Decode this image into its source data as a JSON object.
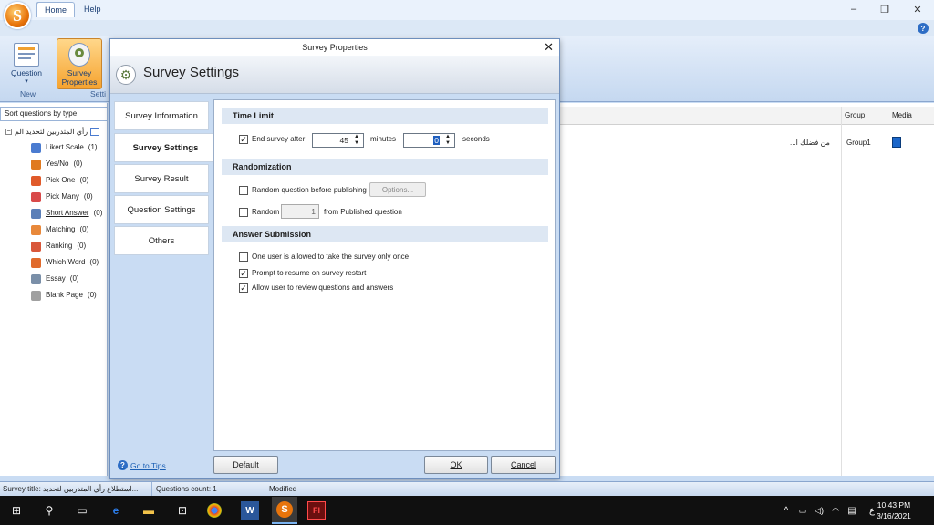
{
  "ribbon": {
    "tabs": [
      "Home",
      "Help"
    ],
    "question_label": "Question",
    "survey_props_label": "Survey Properties",
    "group_new": "New",
    "group_settings": "Setti"
  },
  "left": {
    "sort_label": "Sort questions by type",
    "root_label": "رأي المتدربين لتحديد الم",
    "items": [
      {
        "label": "Likert Scale",
        "count": "(1)",
        "color": "#4a7bd0"
      },
      {
        "label": "Yes/No",
        "count": "(0)",
        "color": "#e07a1f"
      },
      {
        "label": "Pick One",
        "count": "(0)",
        "color": "#e05a2a"
      },
      {
        "label": "Pick Many",
        "count": "(0)",
        "color": "#d94a4a"
      },
      {
        "label": "Short Answer",
        "count": "(0)",
        "color": "#5b7fb8"
      },
      {
        "label": "Matching",
        "count": "(0)",
        "color": "#e8883a"
      },
      {
        "label": "Ranking",
        "count": "(0)",
        "color": "#d9573a"
      },
      {
        "label": "Which Word",
        "count": "(0)",
        "color": "#e06a2c"
      },
      {
        "label": "Essay",
        "count": "(0)",
        "color": "#7a8fa8"
      },
      {
        "label": "Blank Page",
        "count": "(0)",
        "color": "#a0a0a0"
      }
    ]
  },
  "grid": {
    "col_group": "Group",
    "col_media": "Media",
    "row_question": "...من فضلك ا",
    "row_group": "Group1"
  },
  "dialog": {
    "title": "Survey Properties",
    "header": "Survey Settings",
    "nav": [
      "Survey Information",
      "Survey Settings",
      "Survey Result",
      "Question Settings",
      "Others"
    ],
    "time_limit": {
      "heading": "Time Limit",
      "end_after_label": "End survey after",
      "end_after_checked": true,
      "minutes_value": "45",
      "minutes_label": "minutes",
      "seconds_value": "0",
      "seconds_label": "seconds"
    },
    "randomization": {
      "heading": "Randomization",
      "random_before_label": "Random question before publishing",
      "options_label": "Options...",
      "random_label": "Random",
      "random_value": "1",
      "from_published_label": "from Published question"
    },
    "answer_submission": {
      "heading": "Answer Submission",
      "once_label": "One user is allowed to take the survey only once",
      "once_checked": false,
      "resume_label": "Prompt to resume on survey restart",
      "resume_checked": true,
      "review_label": "Allow user to review questions and answers",
      "review_checked": true
    },
    "tips_label": "Go to Tips",
    "default_label": "Default",
    "ok_label": "OK",
    "cancel_label": "Cancel"
  },
  "status": {
    "title": "Survey title: استطلاع رأي المتدربين لتحديد...",
    "count": "Questions count: 1",
    "modified": "Modified"
  },
  "taskbar": {
    "time": "10:43 PM",
    "date": "3/16/2021",
    "lang": "ع"
  }
}
